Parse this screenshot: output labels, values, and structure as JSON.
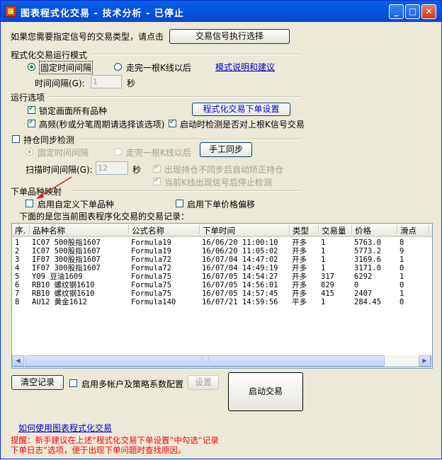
{
  "window": {
    "title": "图表程式化交易 - 技术分析 - 已停止"
  },
  "top": {
    "prompt": "如果您需要指定信号的交易类型，请点击",
    "signal_button": "交易信号执行选择"
  },
  "mode": {
    "section": "程式化交易运行模式",
    "fixed_interval": "固定时间间隔",
    "per_kline": "走完一根K线以后",
    "help_link": "模式说明和建议",
    "interval_label": "时间间隔(G):",
    "interval_value": "1",
    "interval_unit": "秒"
  },
  "options": {
    "section": "运行选项",
    "lock_all": "锁定画面所有品种",
    "order_settings_button": "程式化交易下单设置",
    "high_freq": "高频(秒或分笔周期请选择该选项)",
    "startup_check": "启动时检测是否对上根K信号交易"
  },
  "sync": {
    "section": "持仓同步检测",
    "fixed_interval": "固定时间间隔",
    "per_kline": "走完一根K线以后",
    "manual_sync_button": "手工同步",
    "scan_label": "扫描时间间隔(G):",
    "scan_value": "12",
    "scan_unit": "秒",
    "auto_correct": "出现持仓不同步后自动矫正持仓",
    "stop_on_signal": "当前K线出现信号后停止检测"
  },
  "mapping": {
    "section": "下单品种映射",
    "custom_symbol": "启用自定义下单品种",
    "price_offset": "启用下单价格偏移"
  },
  "records": {
    "caption": "下面的是您当前图表程序化交易的交易记录：",
    "columns": [
      "序.",
      "品种名称",
      "公式名称",
      "下单时间",
      "类型",
      "交易量",
      "价格",
      "滑点"
    ],
    "rows": [
      [
        "1",
        "IC07 500股指1607",
        "Formula19",
        "16/06/20 11:00:10",
        "开多",
        "1",
        "5763.0",
        "8"
      ],
      [
        "2",
        "IC07 500股指1607",
        "Formula19",
        "16/06/20 11:05:02",
        "开多",
        "1",
        "5773.2",
        "9"
      ],
      [
        "3",
        "IF07 300股指1607",
        "Formula72",
        "16/07/04 14:47:02",
        "开多",
        "1",
        "3169.6",
        "1"
      ],
      [
        "4",
        "IF07 300股指1607",
        "Formula72",
        "16/07/04 14:49:19",
        "开多",
        "1",
        "3171.0",
        "0"
      ],
      [
        "5",
        "Y09 豆油1609",
        "Formula75",
        "16/07/05 14:54:27",
        "开多",
        "317",
        "6292",
        "1"
      ],
      [
        "6",
        "RB10 螺纹钢1610",
        "Formula75",
        "16/07/05 14:56:01",
        "开多",
        "829",
        "0",
        "0"
      ],
      [
        "7",
        "RB10 螺纹钢1610",
        "Formula75",
        "16/07/05 14:57:45",
        "开多",
        "415",
        "2407",
        "1"
      ],
      [
        "8",
        "AU12 黄金1612",
        "Formula140",
        "16/07/21 14:59:56",
        "平多",
        "1",
        "284.45",
        "0"
      ]
    ]
  },
  "bottom": {
    "clear_button": "清空记录",
    "multi_account": "启用多帐户及策略系数配置",
    "config_button": "设置",
    "start_button": "启动交易",
    "help_link": "如何使用图表程式化交易",
    "tip_line1": "提醒：新手建议在上述“程式化交易下单设置”中勾选“记录",
    "tip_line2": "下单日志”选项，便于出现下单问题时查找原因。"
  },
  "colors": {
    "titlebar": "#0554e3",
    "link": "#0000cc",
    "tip": "#ff0000",
    "arrow": "#d81e1e"
  }
}
